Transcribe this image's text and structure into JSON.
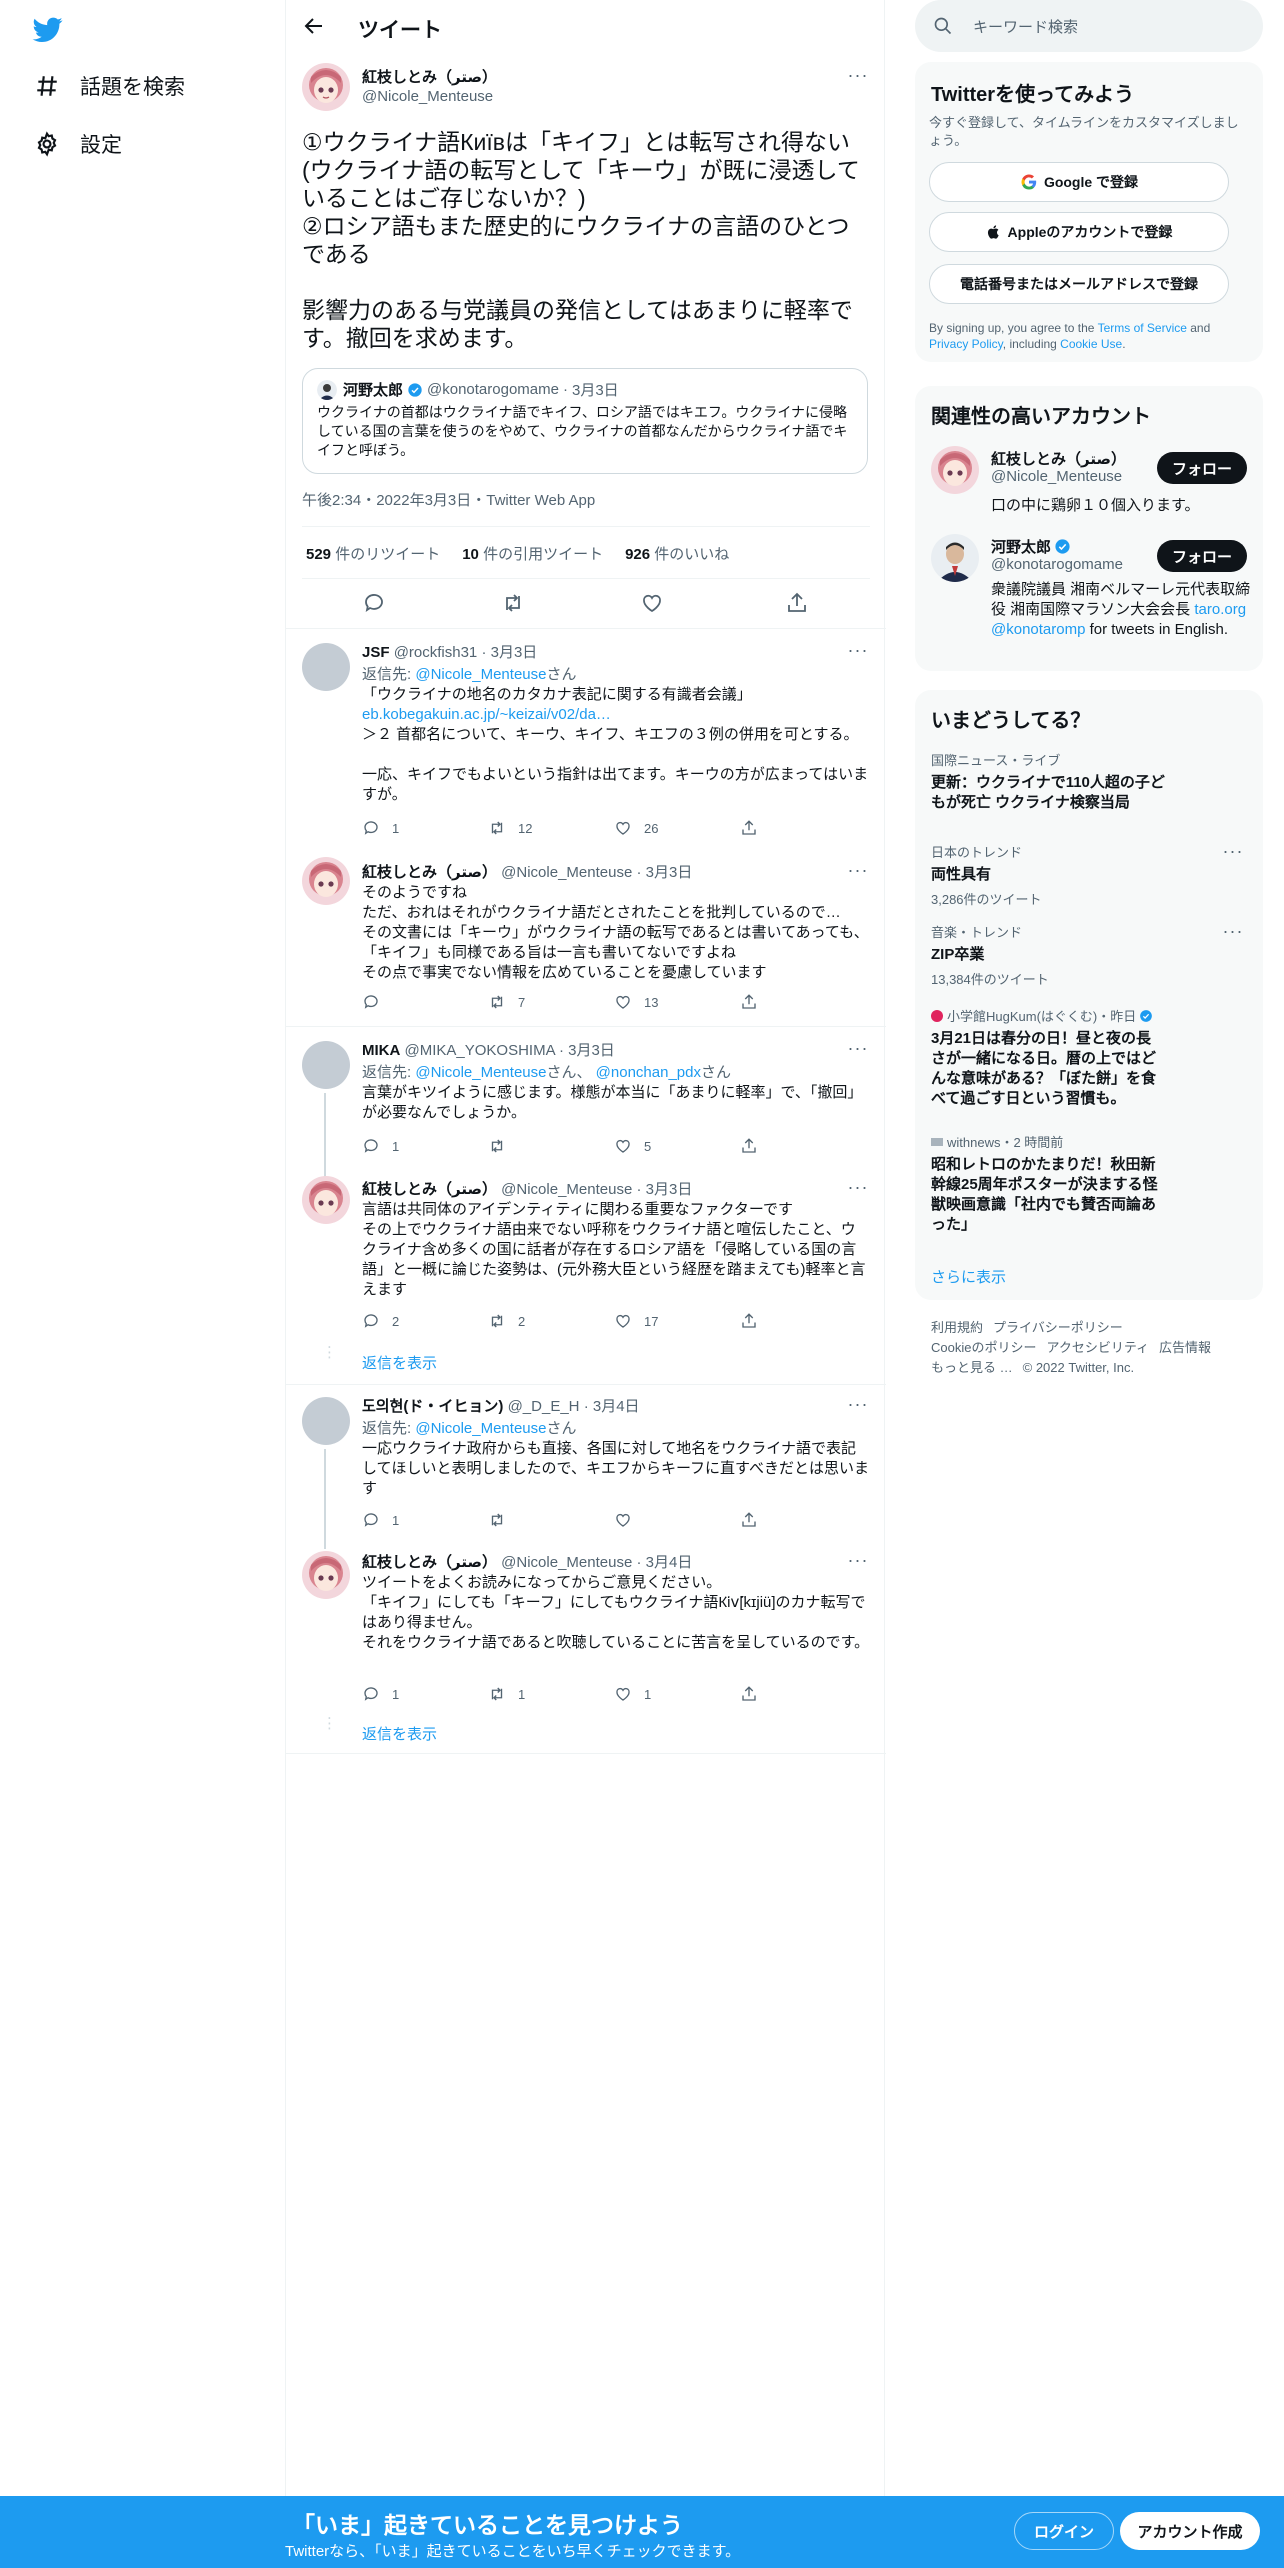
{
  "nav": {
    "explore_label": "話題を検索",
    "settings_label": "設定"
  },
  "header": {
    "title": "ツイート"
  },
  "main_tweet": {
    "author_name": "紅枝しとみ（ﺻﺘﺮ）",
    "author_handle": "@Nicole_Menteuse",
    "text": "①ウクライナ語Київは「キイフ」とは転写され得ない(ウクライナ語の転写として「キーウ」が既に浸透していることはご存じないか？)\n②ロシア語もまた歴史的にウクライナの言語のひとつである\n\n影響力のある与党議員の発信としてはあまりに軽率です。撤回を求めます。",
    "quote": {
      "author_name": "河野太郎",
      "author_handle": "@konotarogomame",
      "date": "3月3日",
      "text": "ウクライナの首都はウクライナ語でキイフ、ロシア語ではキエフ。ウクライナに侵略している国の言葉を使うのをやめて、ウクライナの首都なんだからウクライナ語でキイフと呼ぼう。"
    },
    "timestamp": "午後2:34・2022年3月3日・Twitter Web App",
    "retweets_count": "529",
    "retweets_label": "件のリツイート",
    "quotes_count": "10",
    "quotes_label": "件の引用ツイート",
    "likes_count": "926",
    "likes_label": "件のいいね"
  },
  "replies": [
    {
      "name": "JSF",
      "handle": "@rockfish31",
      "date": "3月3日",
      "reply_to_label": "返信先:",
      "reply_to": "@Nicole_Menteuse",
      "reply_suffix": "さん",
      "text": "「ウクライナの地名のカタカナ表記に関する有識者会議」",
      "link": "eb.kobegakuin.ac.jp/~keizai/v02/da…",
      "text2": "＞２ 首都名について、キーウ、キイフ、キエフの３例の併用を可とする。\n\n一応、キイフでもよいという指針は出てます。キーウの方が広まってはいますが。",
      "replies": "1",
      "retweets": "12",
      "likes": "26"
    },
    {
      "name": "紅枝しとみ（ﺻﺘﺮ）",
      "handle": "@Nicole_Menteuse",
      "date": "3月3日",
      "text": "そのようですね\nただ、おれはそれがウクライナ語だとされたことを批判しているので…\nその文書には「キーウ」がウクライナ語の転写であるとは書いてあっても、「キイフ」も同様である旨は一言も書いてないですよね\nその点で事実でない情報を広めていることを憂慮しています",
      "replies": "",
      "retweets": "7",
      "likes": "13"
    },
    {
      "name": "MIKA",
      "handle": "@MIKA_YOKOSHIMA",
      "date": "3月3日",
      "reply_to_label": "返信先:",
      "reply_to": "@Nicole_Menteuse",
      "reply_mid": "さん、",
      "reply_to2": "@nonchan_pdx",
      "reply_suffix": "さん",
      "text": "言葉がキツイように感じます。様態が本当に「あまりに軽率」で、「撤回」が必要なんでしょうか。",
      "replies": "1",
      "retweets": "",
      "likes": "5"
    },
    {
      "name": "紅枝しとみ（ﺻﺘﺮ）",
      "handle": "@Nicole_Menteuse",
      "date": "3月3日",
      "text": "言語は共同体のアイデンティティに関わる重要なファクターです\nその上でウクライナ語由来でない呼称をウクライナ語と喧伝したこと、ウクライナ含め多くの国に話者が存在するロシア語を「侵略している国の言語」と一概に論じた姿勢は、(元外務大臣という経歴を踏まえても)軽率と言えます",
      "replies": "2",
      "retweets": "2",
      "likes": "17"
    },
    {
      "name": "도의현(ド・イヒョン)",
      "handle": "@_D_E_H",
      "date": "3月4日",
      "reply_to_label": "返信先:",
      "reply_to": "@Nicole_Menteuse",
      "reply_suffix": "さん",
      "text": "一応ウクライナ政府からも直接、各国に対して地名をウクライナ語で表記してほしいと表明しましたので、キエフからキーフに直すべきだとは思います",
      "replies": "1",
      "retweets": "",
      "likes": ""
    },
    {
      "name": "紅枝しとみ（ﺻﺘﺮ）",
      "handle": "@Nicole_Menteuse",
      "date": "3月4日",
      "text": "ツイートをよくお読みになってからご意見ください。\n「キイフ」にしても「キーフ」にしてもウクライナ語К⁠̈іⅴ[⁠̈kɪjiu⁠̈]のカナ転写ではあり得ません。\nそれをウクライナ語であると吹聴していることに苦言を呈しているのです。",
      "replies": "1",
      "retweets": "1",
      "likes": "1"
    }
  ],
  "show_replies_label": "返信を表示",
  "right": {
    "search_placeholder": "キーワード検索",
    "signup_card": {
      "title": "Twitterを使ってみよう",
      "subtitle": "今すぐ登録して、タイムラインをカスタマイズしましょう。",
      "google": "Google で登録",
      "apple": "Appleのアカウントで登録",
      "phone": "電話番号またはメールアドレスで登録",
      "terms_pre": "By signing up, you agree to the ",
      "terms_link": "Terms of Service",
      "terms_and": " and ",
      "privacy_link": "Privacy Policy",
      "terms_including": ", including ",
      "cookie_link": "Cookie Use",
      "terms_end": "."
    },
    "related": {
      "title": "関連性の高いアカウント",
      "follow_label": "フォロー",
      "accounts": [
        {
          "name": "紅枝しとみ（ﺻﺘﺮ）",
          "handle": "@Nicole_Menteuse",
          "bio": "口の中に鶏卵１０個入ります。"
        },
        {
          "name": "河野太郎",
          "handle": "@konotarogomame",
          "bio": "衆議院議員 湘南ベルマーレ元代表取締役 湘南国際マラソン大会会長",
          "bio_link1": "taro.org",
          "bio_link2": "@konotaromp",
          "bio_end": " for tweets in English."
        }
      ]
    },
    "trends": {
      "title": "いまどうしてる？",
      "items": [
        {
          "category": "国際ニュース・ライブ",
          "title": "更新：ウクライナで110人超の子どもが死亡 ウクライナ検察当局",
          "count": ""
        },
        {
          "category": "日本のトレンド",
          "title": "両性具有",
          "count": "3,286件のツイート"
        },
        {
          "category": "音楽・トレンド",
          "title": "ZIP卒業",
          "count": "13,384件のツイート"
        },
        {
          "category": "小学館HugKum(はぐくむ)・昨日",
          "title": "3月21日は春分の日！昼と夜の長さが一緒になる日。暦の上ではどんな意味がある？「ぼた餅」を食べて過ごす日という習慣も。",
          "count": ""
        },
        {
          "category": "withnews・2 時間前",
          "title": "昭和レトロのかたまりだ！秋田新幹線25周年ポスターが決まする怪獣映画意識「社内でも賛否両論あった」",
          "count": ""
        }
      ],
      "show_more": "さらに表示"
    },
    "footer": {
      "l1": "利用規約",
      "l2": "プライバシーポリシー",
      "l3": "Cookieのポリシー",
      "l4": "アクセシビリティ",
      "l5": "広告情報",
      "l6": "もっと見る …",
      "l7": "© 2022 Twitter, Inc."
    }
  },
  "bottom": {
    "title": "「いま」起きていることを見つけよう",
    "subtitle": "Twitterなら、「いま」起きていることをいち早くチェックできます。",
    "login": "ログイン",
    "signup": "アカウント作成"
  }
}
